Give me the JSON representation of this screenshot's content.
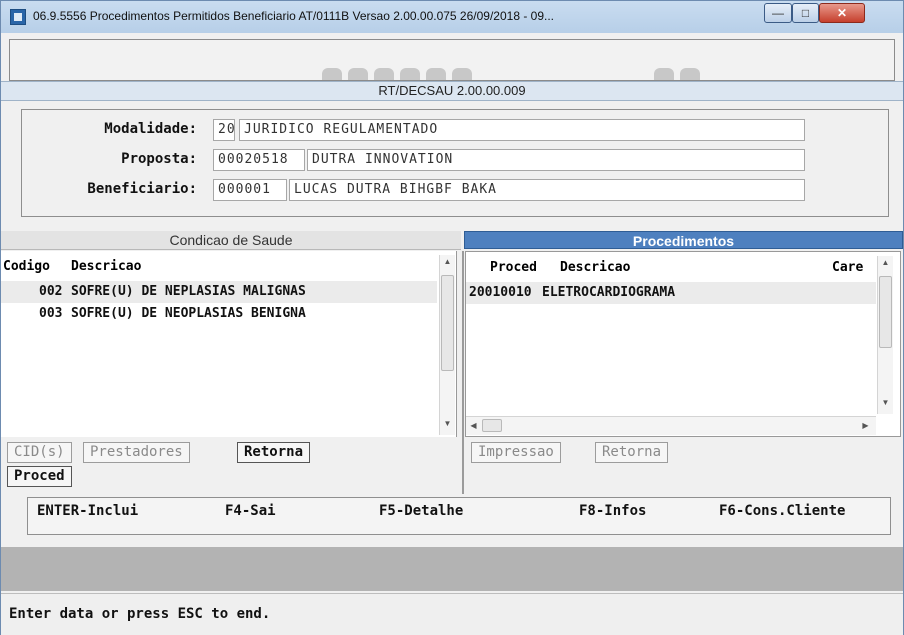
{
  "window": {
    "title": "06.9.5556 Procedimentos Permitidos Beneficiario AT/0111B Versao 2.00.00.075 26/09/2018 - 09..."
  },
  "header": {
    "program": "RT/DECSAU 2.00.00.009"
  },
  "fields": [
    {
      "label": "Modalidade:",
      "code": "20",
      "desc": "JURIDICO REGULAMENTADO"
    },
    {
      "label": "Proposta:",
      "code": "00020518",
      "desc": "DUTRA INNOVATION"
    },
    {
      "label": "Beneficiario:",
      "code": "000001",
      "desc": "LUCAS DUTRA BIHGBF BAKA"
    }
  ],
  "left_panel": {
    "title": "Condicao de Saude",
    "columns": [
      "Codigo",
      "Descricao"
    ],
    "rows": [
      {
        "code": "002",
        "desc": "SOFRE(U) DE NEPLASIAS MALIGNAS"
      },
      {
        "code": "003",
        "desc": "SOFRE(U) DE NEOPLASIAS BENIGNA"
      }
    ],
    "buttons": {
      "cid": "CID(s)",
      "prestadores": "Prestadores",
      "retorna": "Retorna",
      "proced": "Proced"
    }
  },
  "right_panel": {
    "title": "Procedimentos",
    "columns": [
      "Proced",
      "Descricao",
      "Care"
    ],
    "rows": [
      {
        "proced": "20010010",
        "desc": "ELETROCARDIOGRAMA"
      }
    ],
    "buttons": {
      "impressao": "Impressao",
      "retorna": "Retorna"
    }
  },
  "function_keys": [
    "ENTER-Inclui",
    "F4-Sai",
    "F5-Detalhe",
    "F8-Infos",
    "F6-Cons.Cliente"
  ],
  "status": {
    "text": "Enter data or press ESC to end."
  },
  "colors": {
    "accent": "#4e80bf",
    "titlebar": "#b7cfe8",
    "close": "#c6402d"
  }
}
